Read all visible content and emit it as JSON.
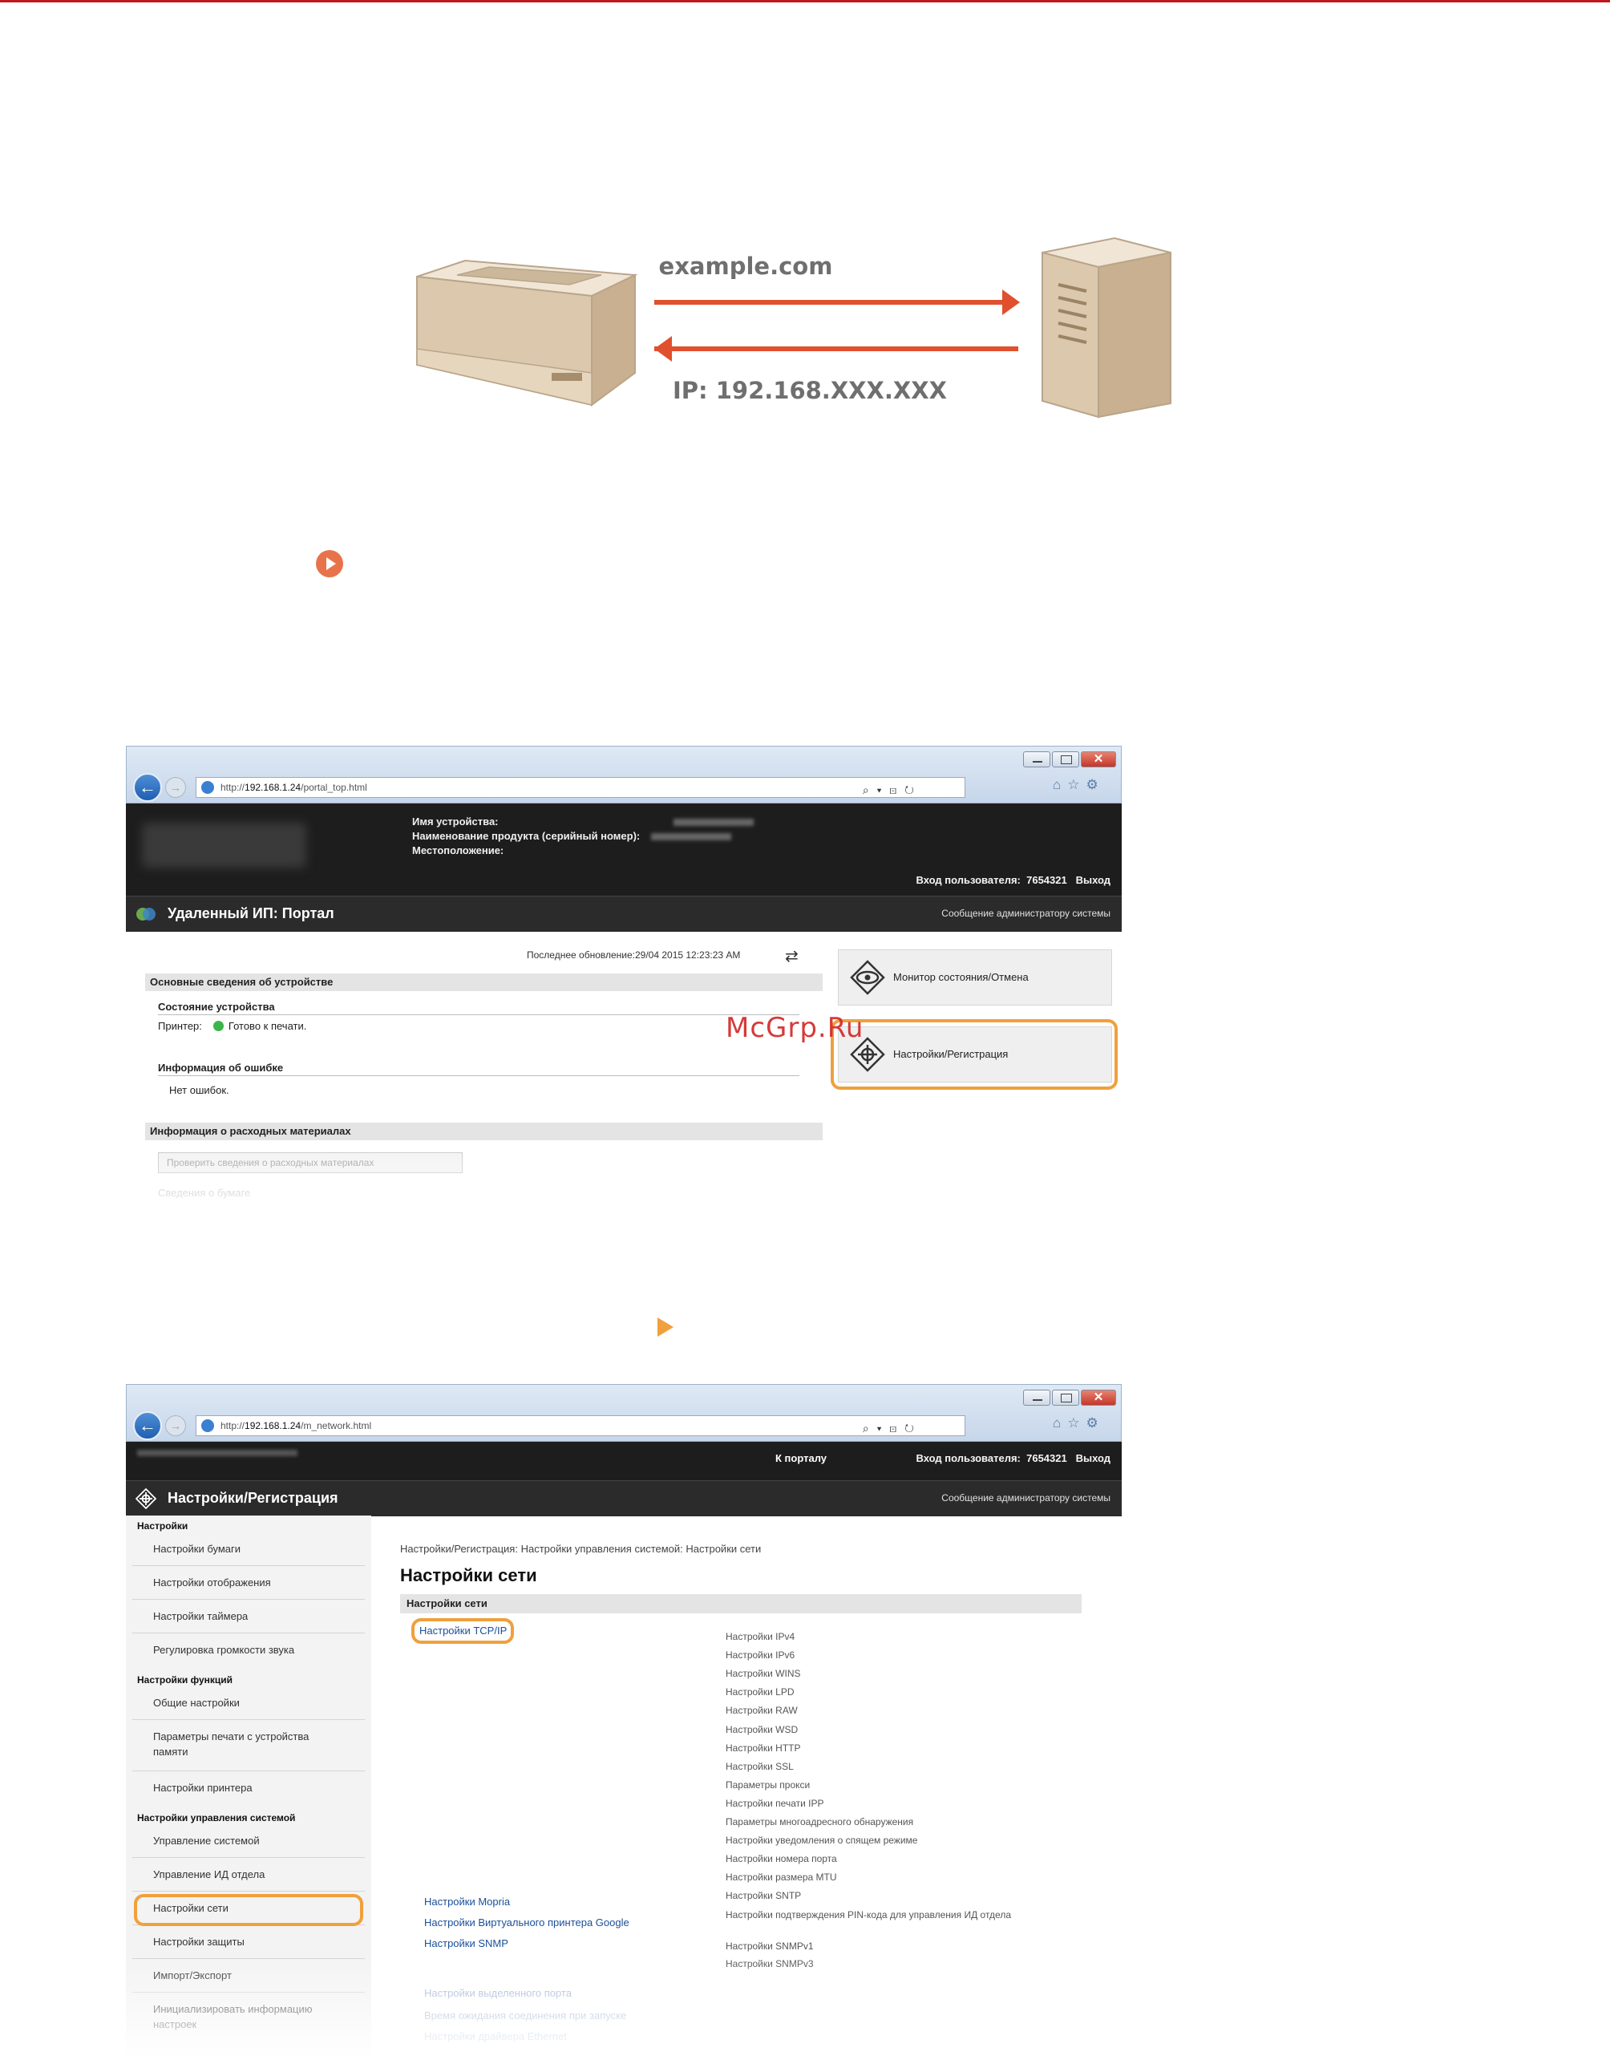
{
  "diagram": {
    "top_label": "example.com",
    "bottom_label": "IP: 192.168.XXX.XXX"
  },
  "watermark": "McGrp.Ru",
  "colors": {
    "accent_orange": "#f0a03c",
    "brand_red": "#c0161d",
    "arrow_red": "#e0502e",
    "bullet": "#e8734a"
  },
  "window1": {
    "url_prefix": "http://",
    "url_host": "192.168.1.24",
    "url_path": "/portal_top.html",
    "device_info": {
      "name_label": "Имя устройства:",
      "product_label": "Наименование продукта (серийный номер):",
      "location_label": "Местоположение:"
    },
    "login_label": "Вход пользователя:",
    "login_user": "7654321",
    "logout": "Выход",
    "title": "Удаленный ИП: Портал",
    "admin_link": "Сообщение администратору системы",
    "last_update": "Последнее обновление:29/04 2015 12:23:23 AM",
    "basic_info_header": "Основные сведения об устройстве",
    "device_status_header": "Состояние устройства",
    "printer_label": "Принтер:",
    "printer_status": "Готово к печати.",
    "error_header": "Информация об ошибке",
    "error_value": "Нет ошибок.",
    "consumables_header": "Информация о расходных материалах",
    "consumables_button": "Проверить сведения о расходных материалах",
    "faded_item": "Сведения о бумаге",
    "side_buttons": [
      {
        "label": "Монитор состояния/Отмена",
        "icon": "eye-icon"
      },
      {
        "label": "Настройки/Регистрация",
        "icon": "settings-icon"
      }
    ]
  },
  "window2": {
    "url_prefix": "http://",
    "url_host": "192.168.1.24",
    "url_path": "/m_network.html",
    "to_portal": "К порталу",
    "login_label": "Вход пользователя:",
    "login_user": "7654321",
    "logout": "Выход",
    "title": "Настройки/Регистрация",
    "admin_link": "Сообщение администратору системы",
    "sidebar": {
      "group1": "Настройки",
      "items1": [
        "Настройки бумаги",
        "Настройки отображения",
        "Настройки таймера",
        "Регулировка громкости звука"
      ],
      "group2": "Настройки функций",
      "items2": [
        "Общие настройки",
        "Параметры печати с устройства памяти",
        "Настройки принтера"
      ],
      "group3": "Настройки управления системой",
      "items3": [
        "Управление системой",
        "Управление ИД отдела",
        "Настройки сети",
        "Настройки защиты",
        "Импорт/Экспорт",
        "Инициализировать информацию настроек"
      ]
    },
    "breadcrumb": "Настройки/Регистрация: Настройки управления системой: Настройки сети",
    "page_title": "Настройки сети",
    "section_header": "Настройки сети",
    "tcpip_link": "Настройки TCP/IP",
    "tcpip_subitems": [
      "Настройки IPv4",
      "Настройки IPv6",
      "Настройки WINS",
      "Настройки LPD",
      "Настройки RAW",
      "Настройки WSD",
      "Настройки HTTP",
      "Настройки SSL",
      "Параметры прокси",
      "Настройки печати IPP",
      "Параметры многоадресного обнаружения",
      "Настройки уведомления о спящем режиме",
      "Настройки номера порта",
      "Настройки размера MTU",
      "Настройки SNTP",
      "Настройки подтверждения PIN-кода для управления ИД отдела"
    ],
    "mopria_link": "Настройки Mopria",
    "google_link": "Настройки Виртуального принтера Google",
    "snmp_link": "Настройки SNMP",
    "snmp_subitems": [
      "Настройки SNMPv1",
      "Настройки SNMPv3"
    ],
    "dedicated_port_link": "Настройки выделенного порта",
    "wait_link": "Время ожидания соединения при запуске",
    "ethernet_link": "Настройки драйвера Ethernet"
  }
}
